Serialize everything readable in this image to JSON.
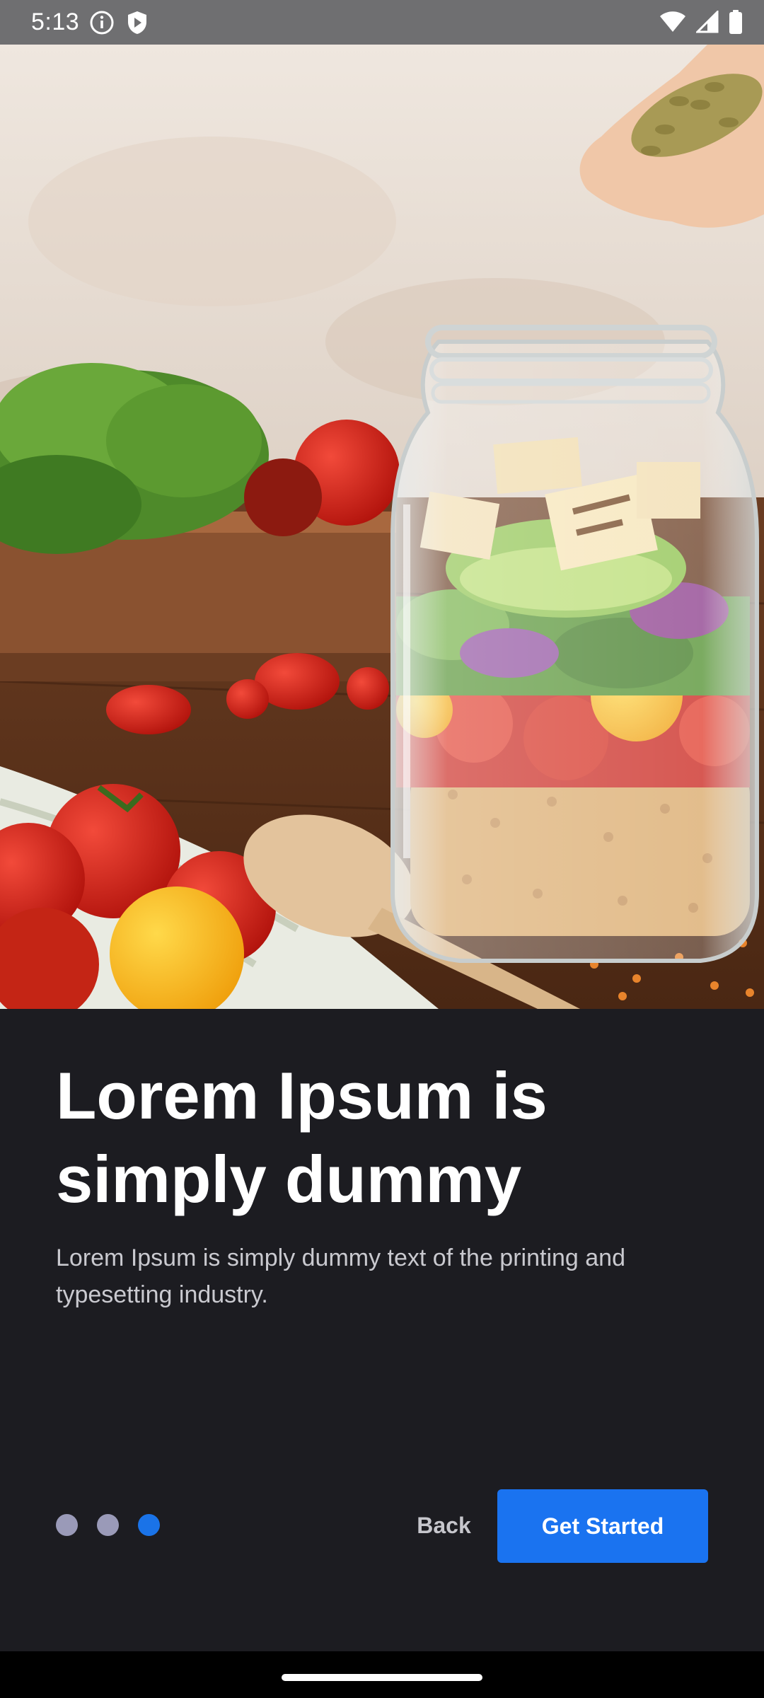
{
  "status_bar": {
    "time": "5:13",
    "left_icons": [
      "info-icon",
      "shield-icon"
    ],
    "right_icons": [
      "wifi-icon",
      "signal-icon",
      "battery-icon"
    ]
  },
  "hero": {
    "image": "salad-jar-photo"
  },
  "onboarding": {
    "title": "Lorem Ipsum is simply dummy",
    "description": "Lorem Ipsum is simply dummy text of the printing and typesetting industry.",
    "page_count": 3,
    "current_page": 3
  },
  "actions": {
    "back_label": "Back",
    "primary_label": "Get Started"
  },
  "colors": {
    "background": "#1c1c21",
    "accent": "#1a73f0",
    "dot_inactive": "#9a9ab8",
    "status_bar": "#6f6f71"
  }
}
